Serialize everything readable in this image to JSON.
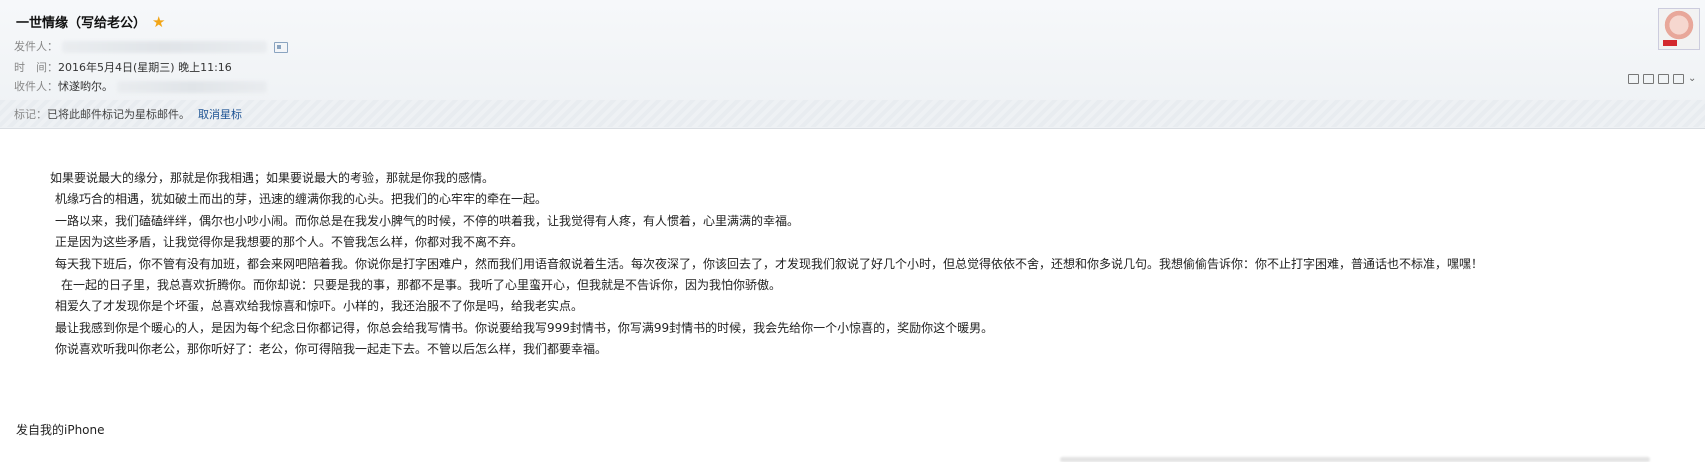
{
  "mail": {
    "subject": "一世情缘（写给老公）",
    "sender_label": "发件人：",
    "time_label": "时　间：",
    "time_value": "2016年5月4日(星期三) 晚上11:16",
    "recipient_label": "收件人：",
    "recipient_value": "怵遂哟尔。",
    "tag_label": "标记：",
    "tag_text": "已将此邮件标记为星标邮件。",
    "unstar_label": "取消星标"
  },
  "icons": {
    "star": "star-icon",
    "contact": "contact-card-icon",
    "toolbar": [
      "new-window-icon",
      "copy-icon",
      "export-icon",
      "print-icon",
      "chevron-down-icon"
    ]
  },
  "colors": {
    "star": "#f2a516",
    "link": "#1e5494"
  },
  "body": {
    "paragraphs": [
      "如果要说最大的缘分，那就是你我相遇；如果要说最大的考验，那就是你我的感情。",
      "机缘巧合的相遇，犹如破土而出的芽，迅速的缠满你我的心头。把我们的心牢牢的牵在一起。",
      "一路以来，我们磕磕绊绊，偶尔也小吵小闹。而你总是在我发小脾气的时候，不停的哄着我，让我觉得有人疼，有人惯着，心里满满的幸福。",
      "正是因为这些矛盾，让我觉得你是我想要的那个人。不管我怎么样，你都对我不离不弃。",
      "每天我下班后，你不管有没有加班，都会来网吧陪着我。你说你是打字困难户，然而我们用语音叙说着生活。每次夜深了，你该回去了，才发现我们叙说了好几个小时，但总觉得依依不舍，还想和你多说几句。我想偷偷告诉你：你不止打字困难，普通话也不标准，嘿嘿！",
      "在一起的日子里，我总喜欢折腾你。而你却说：只要是我的事，那都不是事。我听了心里蛮开心，但我就是不告诉你，因为我怕你骄傲。",
      "相爱久了才发现你是个坏蛋，总喜欢给我惊喜和惊吓。小样的，我还治服不了你是吗，给我老实点。",
      "最让我感到你是个暖心的人，是因为每个纪念日你都记得，你总会给我写情书。你说要给我写999封情书，你写满99封情书的时候，我会先给你一个小惊喜的，奖励你这个暖男。",
      "你说喜欢听我叫你老公，那你听好了：老公，你可得陪我一起走下去。不管以后怎么样，我们都要幸福。"
    ],
    "signature": "发自我的iPhone"
  }
}
